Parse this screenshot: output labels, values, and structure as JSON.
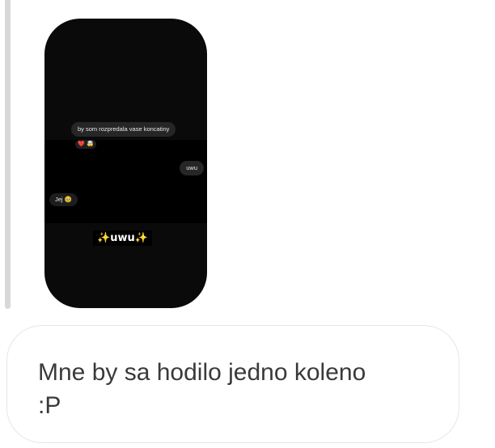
{
  "story": {
    "messages": {
      "first": "by som rozpredala vase koncatiny",
      "reactions": "❤️ 🤯",
      "second": "uwu",
      "third": "Jej 🥹"
    },
    "sticker": {
      "sparkle_left": "✨",
      "text": "uwu",
      "sparkle_right": "✨"
    }
  },
  "comment": {
    "text": "Mne by sa hodilo jedno koleno\n:P"
  }
}
